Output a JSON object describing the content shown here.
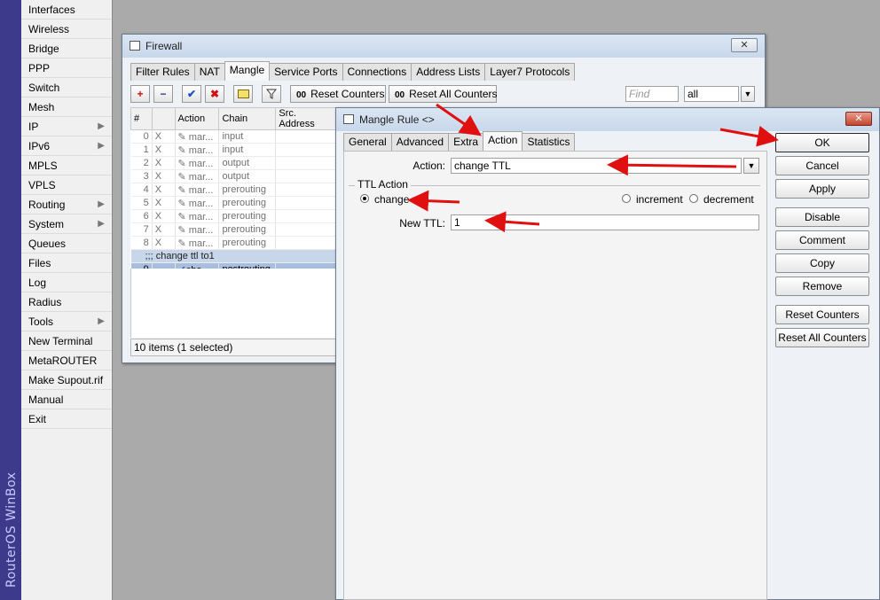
{
  "branding": {
    "vertical_text": "RouterOS WinBox"
  },
  "sidebar": {
    "items": [
      {
        "label": "Interfaces",
        "submenu": false
      },
      {
        "label": "Wireless",
        "submenu": false
      },
      {
        "label": "Bridge",
        "submenu": false
      },
      {
        "label": "PPP",
        "submenu": false
      },
      {
        "label": "Switch",
        "submenu": false
      },
      {
        "label": "Mesh",
        "submenu": false
      },
      {
        "label": "IP",
        "submenu": true
      },
      {
        "label": "IPv6",
        "submenu": true
      },
      {
        "label": "MPLS",
        "submenu": false
      },
      {
        "label": "VPLS",
        "submenu": false
      },
      {
        "label": "Routing",
        "submenu": true
      },
      {
        "label": "System",
        "submenu": true
      },
      {
        "label": "Queues",
        "submenu": false
      },
      {
        "label": "Files",
        "submenu": false
      },
      {
        "label": "Log",
        "submenu": false
      },
      {
        "label": "Radius",
        "submenu": false
      },
      {
        "label": "Tools",
        "submenu": true
      },
      {
        "label": "New Terminal",
        "submenu": false
      },
      {
        "label": "MetaROUTER",
        "submenu": false
      },
      {
        "label": "Make Supout.rif",
        "submenu": false
      },
      {
        "label": "Manual",
        "submenu": false
      },
      {
        "label": "Exit",
        "submenu": false
      }
    ]
  },
  "firewall": {
    "title": "Firewall",
    "tabs": [
      "Filter Rules",
      "NAT",
      "Mangle",
      "Service Ports",
      "Connections",
      "Address Lists",
      "Layer7 Protocols"
    ],
    "active_tab": "Mangle",
    "toolbar": {
      "add": "+",
      "remove": "−",
      "enable": "✔",
      "disable": "✖",
      "comment": "",
      "filter": "",
      "reset_counters": "Reset Counters",
      "reset_all_counters": "Reset All Counters",
      "counter_prefix": "00",
      "find_placeholder": "Find",
      "filter_value": "all"
    },
    "columns": [
      "#",
      "",
      "Action",
      "Chain",
      "Src. Address"
    ],
    "rows": [
      {
        "num": "0",
        "flag": "X",
        "action": "mar...",
        "chain": "input"
      },
      {
        "num": "1",
        "flag": "X",
        "action": "mar...",
        "chain": "input"
      },
      {
        "num": "2",
        "flag": "X",
        "action": "mar...",
        "chain": "output"
      },
      {
        "num": "3",
        "flag": "X",
        "action": "mar...",
        "chain": "output"
      },
      {
        "num": "4",
        "flag": "X",
        "action": "mar...",
        "chain": "prerouting"
      },
      {
        "num": "5",
        "flag": "X",
        "action": "mar...",
        "chain": "prerouting"
      },
      {
        "num": "6",
        "flag": "X",
        "action": "mar...",
        "chain": "prerouting"
      },
      {
        "num": "7",
        "flag": "X",
        "action": "mar...",
        "chain": "prerouting"
      },
      {
        "num": "8",
        "flag": "X",
        "action": "mar...",
        "chain": "prerouting"
      }
    ],
    "comment_row": ";;; change ttl to1",
    "selected_row": {
      "num": "9",
      "flag": "",
      "action": "cha...",
      "chain": "postrouting"
    },
    "status": "10 items (1 selected)"
  },
  "mangle_rule": {
    "title": "Mangle Rule <>",
    "tabs": [
      "General",
      "Advanced",
      "Extra",
      "Action",
      "Statistics"
    ],
    "active_tab": "Action",
    "action_label": "Action:",
    "action_value": "change TTL",
    "ttl_group_label": "TTL Action",
    "ttl_options": [
      "change",
      "increment",
      "decrement"
    ],
    "ttl_selected": "change",
    "new_ttl_label": "New TTL:",
    "new_ttl_value": "1",
    "buttons": [
      "OK",
      "Cancel",
      "Apply",
      "Disable",
      "Comment",
      "Copy",
      "Remove",
      "Reset Counters",
      "Reset All Counters"
    ]
  },
  "colors": {
    "annotation_arrow": "#e01010",
    "brand_strip": "#3d3a8c"
  }
}
